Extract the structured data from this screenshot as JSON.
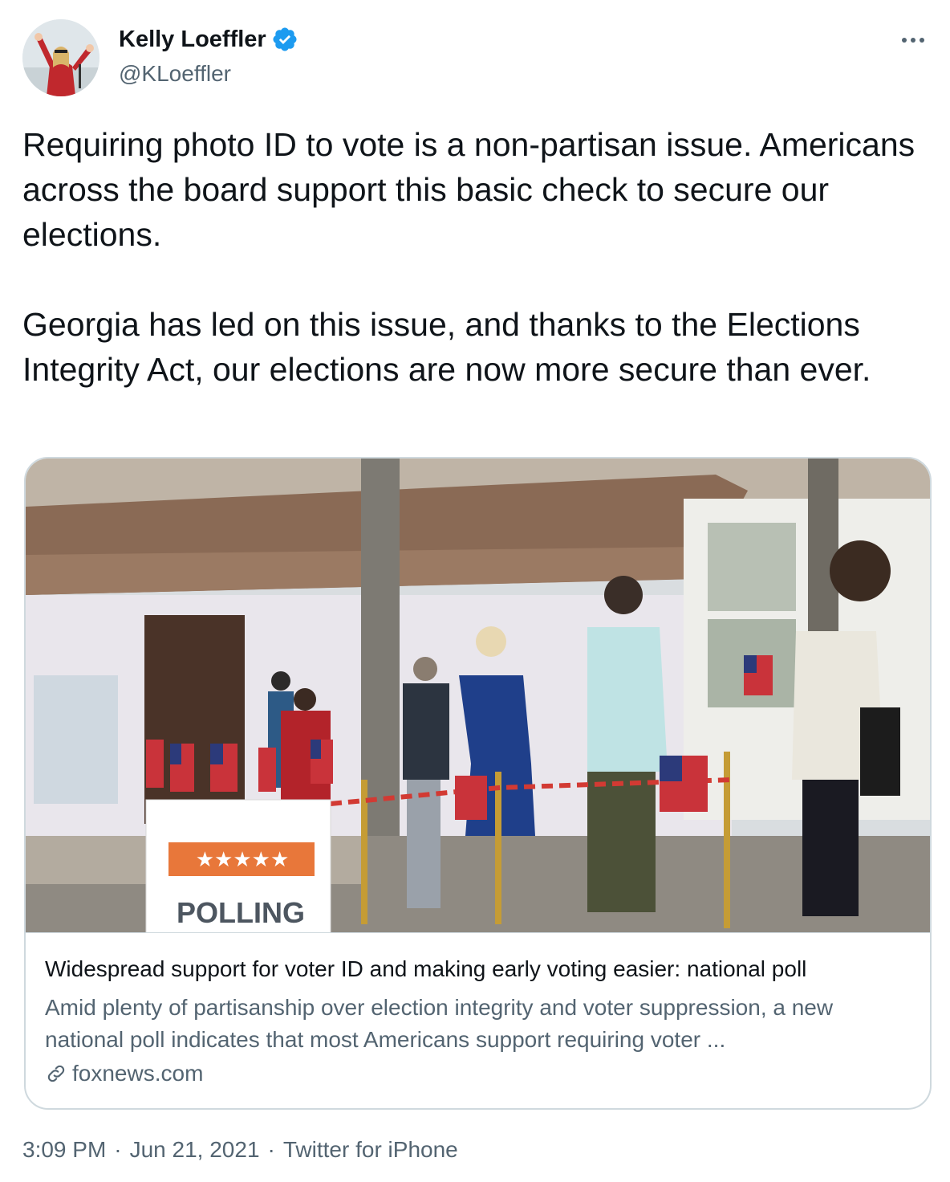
{
  "author": {
    "name": "Kelly Loeffler",
    "handle": "@KLoeffler",
    "verified": true
  },
  "tweet": {
    "text": "Requiring photo ID to vote is a non-partisan issue. Americans across the board support this basic check to secure our elections.\n\nGeorgia has led on this issue, and thanks to the Elections Integrity Act, our elections are now more secure than ever."
  },
  "card": {
    "title": "Widespread support for voter ID and making early voting easier: national poll",
    "description": "Amid plenty of partisanship over election integrity and voter suppression, a new national poll indicates that most Americans support requiring voter ...",
    "domain": "foxnews.com",
    "image_sign_text": "POLLING"
  },
  "meta": {
    "time": "3:09 PM",
    "separator": "·",
    "date": "Jun 21, 2021",
    "source": "Twitter for iPhone"
  },
  "colors": {
    "text": "#0f1419",
    "secondary": "#536471",
    "verified_blue": "#1d9bf0",
    "border": "#cfd9de"
  }
}
